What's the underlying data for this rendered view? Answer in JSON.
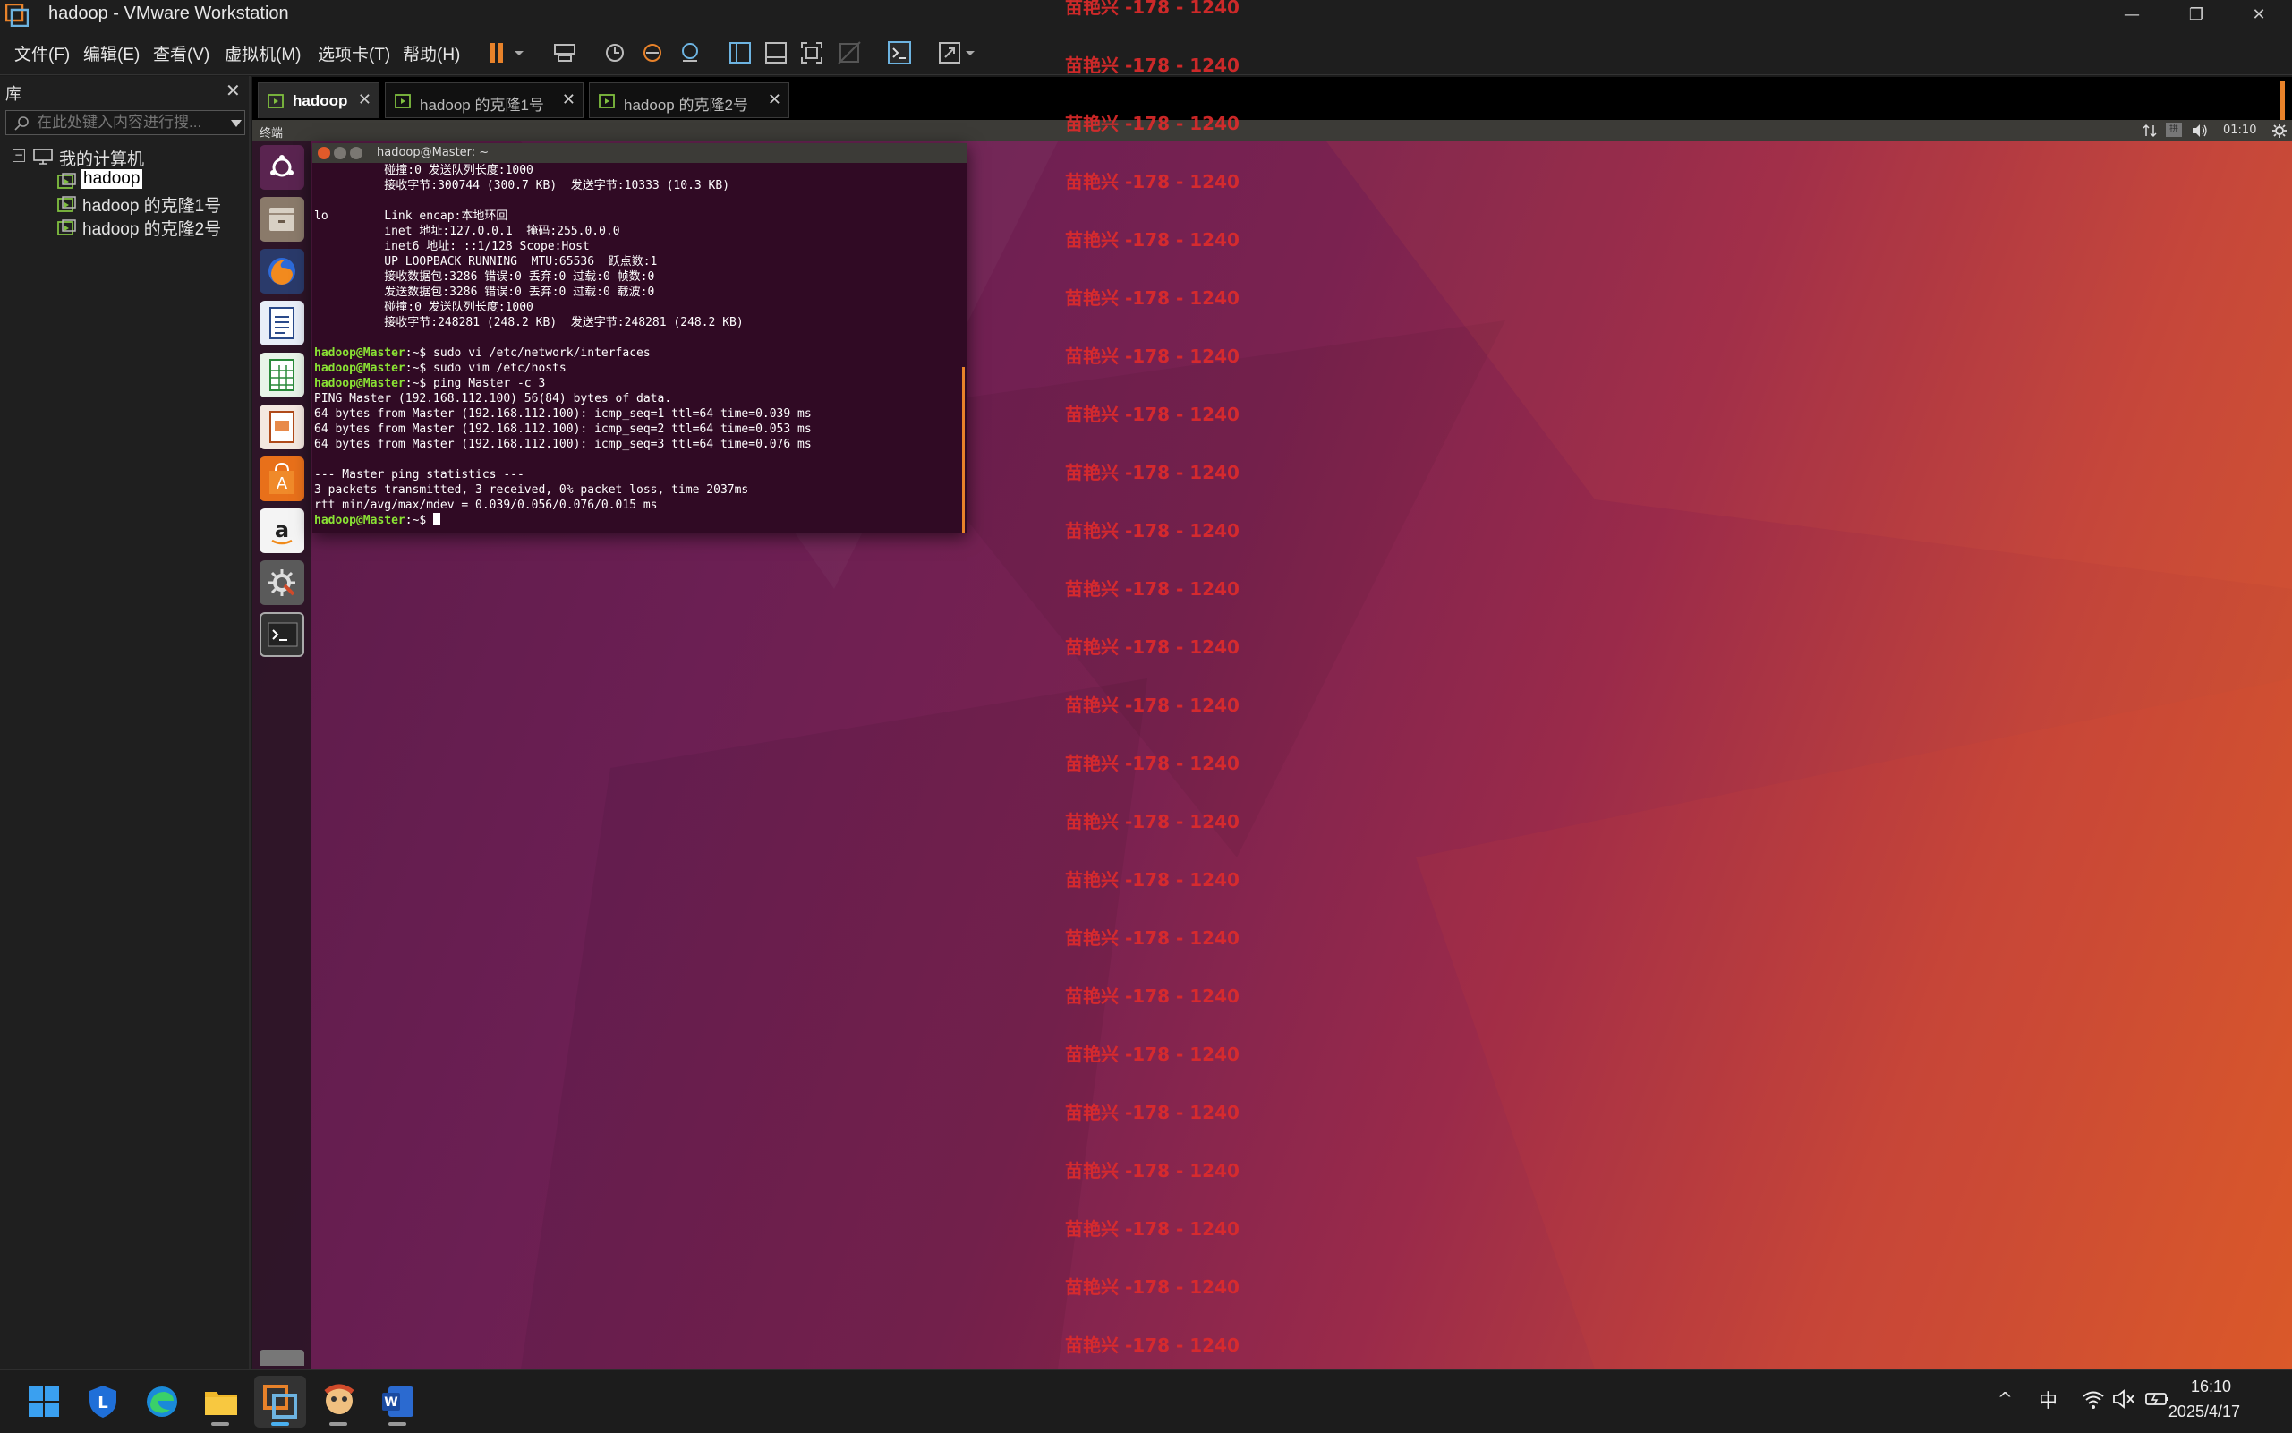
{
  "window": {
    "title": "hadoop - VMware Workstation",
    "minimize": "—",
    "restore": "❐",
    "close": "✕"
  },
  "menu": [
    "文件(F)",
    "编辑(E)",
    "查看(V)",
    "虚拟机(M)",
    "选项卡(T)",
    "帮助(H)"
  ],
  "library": {
    "header": "库",
    "close": "✕",
    "search_placeholder": "在此处键入内容进行搜...",
    "root": "我的计算机",
    "items": [
      "hadoop",
      "hadoop 的克隆1号",
      "hadoop 的克隆2号"
    ],
    "selected": "hadoop"
  },
  "tabs": [
    {
      "label": "hadoop",
      "active": true
    },
    {
      "label": "hadoop 的克隆1号",
      "active": false
    },
    {
      "label": "hadoop 的克隆2号",
      "active": false
    }
  ],
  "ubuntu": {
    "app_label": "终端",
    "time": "01:10"
  },
  "terminal": {
    "title": "hadoop@Master: ~",
    "lines": [
      {
        "text": "          碰撞:0 发送队列长度:1000"
      },
      {
        "text": "          接收字节:300744 (300.7 KB)  发送字节:10333 (10.3 KB)"
      },
      {
        "text": ""
      },
      {
        "text": "lo        Link encap:本地环回"
      },
      {
        "text": "          inet 地址:127.0.0.1  掩码:255.0.0.0"
      },
      {
        "text": "          inet6 地址: ::1/128 Scope:Host"
      },
      {
        "text": "          UP LOOPBACK RUNNING  MTU:65536  跃点数:1"
      },
      {
        "text": "          接收数据包:3286 错误:0 丢弃:0 过载:0 帧数:0"
      },
      {
        "text": "          发送数据包:3286 错误:0 丢弃:0 过载:0 载波:0"
      },
      {
        "text": "          碰撞:0 发送队列长度:1000"
      },
      {
        "text": "          接收字节:248281 (248.2 KB)  发送字节:248281 (248.2 KB)"
      },
      {
        "text": ""
      },
      {
        "prompt": "hadoop@Master",
        "text": ":~$ sudo vi /etc/network/interfaces"
      },
      {
        "prompt": "hadoop@Master",
        "text": ":~$ sudo vim /etc/hosts"
      },
      {
        "prompt": "hadoop@Master",
        "text": ":~$ ping Master -c 3"
      },
      {
        "text": "PING Master (192.168.112.100) 56(84) bytes of data."
      },
      {
        "text": "64 bytes from Master (192.168.112.100): icmp_seq=1 ttl=64 time=0.039 ms"
      },
      {
        "text": "64 bytes from Master (192.168.112.100): icmp_seq=2 ttl=64 time=0.053 ms"
      },
      {
        "text": "64 bytes from Master (192.168.112.100): icmp_seq=3 ttl=64 time=0.076 ms"
      },
      {
        "text": ""
      },
      {
        "text": "--- Master ping statistics ---"
      },
      {
        "text": "3 packets transmitted, 3 received, 0% packet loss, time 2037ms"
      },
      {
        "text": "rtt min/avg/max/mdev = 0.039/0.056/0.076/0.015 ms"
      },
      {
        "prompt": "hadoop@Master",
        "text": ":~$ "
      }
    ]
  },
  "watermark": {
    "text": "苗艳兴 -178 - 1240",
    "count": 25
  },
  "taskbar": {
    "ime": "中",
    "time": "16:10",
    "date": "2025/4/17",
    "chevron": "^"
  },
  "colors": {
    "prompt": "#8ae234",
    "terminal_bg": "#300a24",
    "accent": "#e8822a",
    "watermark": "#e02b2b"
  }
}
